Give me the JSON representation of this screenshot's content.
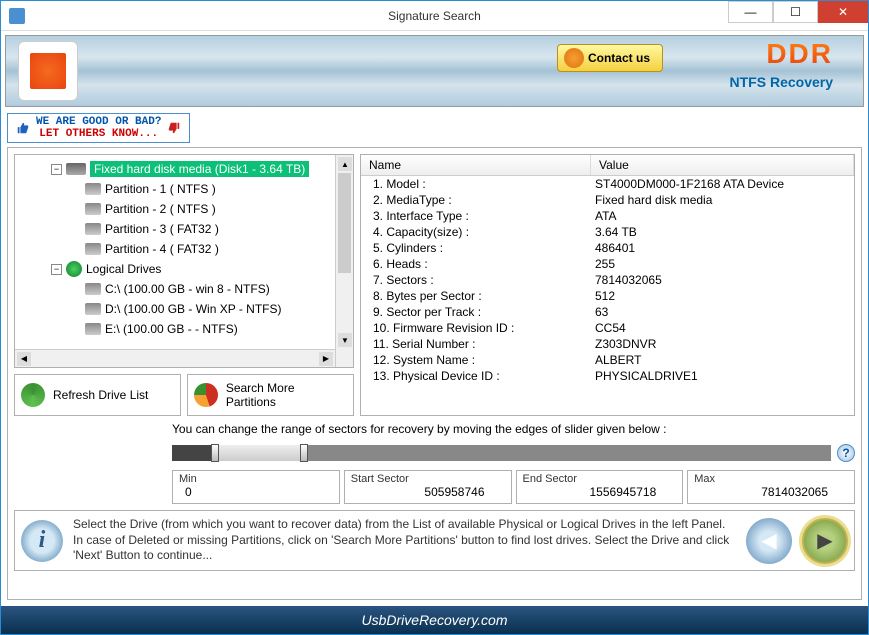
{
  "window": {
    "title": "Signature Search"
  },
  "banner": {
    "contact": "Contact us",
    "brand": "DDR",
    "subtitle": "NTFS Recovery"
  },
  "feedback": {
    "line1": "WE ARE GOOD OR BAD?",
    "line2": "LET OTHERS KNOW..."
  },
  "tree": {
    "root": "Fixed hard disk media (Disk1 - 3.64 TB)",
    "partitions": [
      "Partition - 1 ( NTFS )",
      "Partition - 2 ( NTFS )",
      "Partition - 3 ( FAT32 )",
      "Partition - 4 ( FAT32 )"
    ],
    "logical_label": "Logical Drives",
    "logical": [
      "C:\\ (100.00 GB - win 8 - NTFS)",
      "D:\\ (100.00 GB - Win XP - NTFS)",
      "E:\\ (100.00 GB -  - NTFS)"
    ]
  },
  "buttons": {
    "refresh": "Refresh Drive List",
    "search": "Search More Partitions"
  },
  "table": {
    "head_name": "Name",
    "head_value": "Value",
    "rows": [
      {
        "name": "1. Model :",
        "value": "ST4000DM000-1F2168 ATA Device"
      },
      {
        "name": "2. MediaType :",
        "value": "Fixed hard disk media"
      },
      {
        "name": "3. Interface Type :",
        "value": "ATA"
      },
      {
        "name": "4. Capacity(size) :",
        "value": "3.64 TB"
      },
      {
        "name": "5. Cylinders :",
        "value": "486401"
      },
      {
        "name": "6. Heads :",
        "value": "255"
      },
      {
        "name": "7. Sectors :",
        "value": "7814032065"
      },
      {
        "name": "8. Bytes per Sector :",
        "value": "512"
      },
      {
        "name": "9. Sector per Track :",
        "value": "63"
      },
      {
        "name": "10. Firmware Revision ID :",
        "value": "CC54"
      },
      {
        "name": "11. Serial Number :",
        "value": "Z303DNVR"
      },
      {
        "name": "12. System Name :",
        "value": "ALBERT"
      },
      {
        "name": "13. Physical Device ID :",
        "value": "PHYSICALDRIVE1"
      }
    ]
  },
  "slider": {
    "caption": "You can change the range of sectors for recovery by moving the edges of slider given below :",
    "min_label": "Min",
    "min_value": "0",
    "start_label": "Start Sector",
    "start_value": "505958746",
    "end_label": "End Sector",
    "end_value": "1556945718",
    "max_label": "Max",
    "max_value": "7814032065"
  },
  "info": {
    "text": "Select the Drive (from which you want to recover data) from the List of available Physical or Logical Drives in the left Panel. In case of Deleted or missing Partitions, click on 'Search More Partitions' button to find lost drives. Select the Drive and click 'Next' Button to continue..."
  },
  "footer": {
    "url": "UsbDriveRecovery.com"
  }
}
